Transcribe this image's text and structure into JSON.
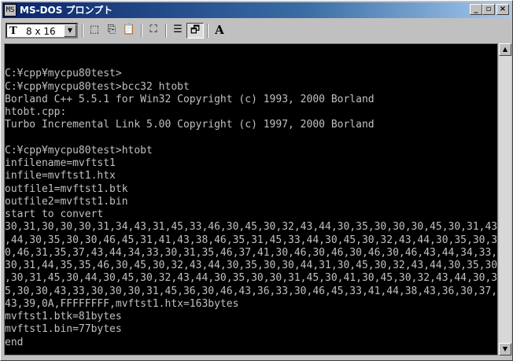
{
  "window": {
    "title": "MS-DOS プロンプト",
    "icon_label": "MS",
    "minimize_glyph": "_",
    "maximize_glyph": "▫",
    "close_glyph": "×"
  },
  "toolbar": {
    "font_prefix": "T",
    "font_size": "8 x 16",
    "dropdown_glyph": "▼",
    "tools": [
      {
        "name": "mark-icon",
        "glyph": "⬚"
      },
      {
        "name": "copy-icon",
        "glyph": "⎘"
      },
      {
        "name": "paste-icon",
        "glyph": "📋"
      },
      {
        "name": "fullscreen-icon",
        "glyph": "⛶"
      },
      {
        "name": "properties-icon",
        "glyph": "☰"
      },
      {
        "name": "background-icon",
        "glyph": "🗗"
      },
      {
        "name": "font-icon",
        "glyph": "A"
      }
    ]
  },
  "console": {
    "lines": [
      "",
      "C:¥cpp¥mycpu80test>",
      "C:¥cpp¥mycpu80test>bcc32 htobt",
      "Borland C++ 5.5.1 for Win32 Copyright (c) 1993, 2000 Borland",
      "htobt.cpp:",
      "Turbo Incremental Link 5.00 Copyright (c) 1997, 2000 Borland",
      "",
      "C:¥cpp¥mycpu80test>htobt",
      "infilename=mvftst1",
      "infile=mvftst1.htx",
      "outfile1=mvftst1.btk",
      "outfile2=mvftst1.bin",
      "start to convert",
      "30,31,30,30,30,31,34,43,31,45,33,46,30,45,30,32,43,44,30,35,30,30,30,45,30,31,43",
      ",44,30,35,30,30,46,45,31,41,43,38,46,35,31,45,33,44,30,45,30,32,43,44,30,35,30,3",
      "0,46,31,35,37,43,44,34,33,30,31,35,46,37,41,30,46,30,46,30,46,30,46,43,44,34,33,",
      "30,31,44,35,35,46,30,45,30,32,43,44,30,35,30,30,44,31,30,45,30,32,43,44,30,35,30",
      ",30,31,45,30,44,30,45,30,32,43,44,30,35,30,30,31,45,30,41,30,45,30,32,43,44,30,3",
      "5,30,30,43,33,30,30,30,31,45,36,30,46,43,36,33,30,46,45,33,41,44,38,43,36,30,37,",
      "43,39,0A,FFFFFFFF,mvftst1.htx=163bytes",
      "mvftst1.btk=81bytes",
      "mvftst1.bin=77bytes",
      "end",
      "",
      "C:¥cpp¥mycpu80test>"
    ]
  },
  "scrollbar": {
    "up_glyph": "▲",
    "down_glyph": "▼"
  }
}
